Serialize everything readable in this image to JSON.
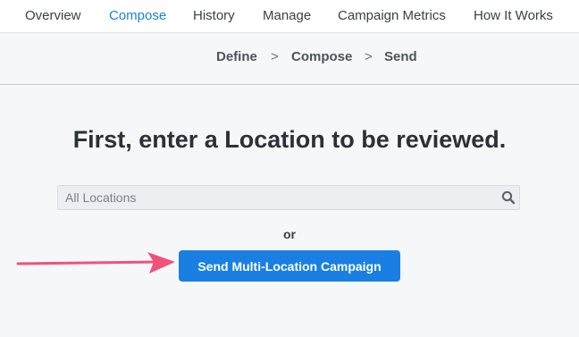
{
  "nav": {
    "items": [
      {
        "label": "Overview",
        "active": false
      },
      {
        "label": "Compose",
        "active": true
      },
      {
        "label": "History",
        "active": false
      },
      {
        "label": "Manage",
        "active": false
      },
      {
        "label": "Campaign Metrics",
        "active": false
      },
      {
        "label": "How It Works",
        "active": false
      }
    ]
  },
  "breadcrumb": {
    "steps": [
      "Define",
      "Compose",
      "Send"
    ],
    "separator": ">"
  },
  "main": {
    "heading": "First, enter a Location to be reviewed.",
    "search_placeholder": "All Locations",
    "search_value": "",
    "search_icon": "search-icon",
    "or_text": "or",
    "button_label": "Send Multi-Location Campaign"
  },
  "annotation": {
    "arrow_icon": "arrow-right-icon"
  },
  "colors": {
    "accent": "#1a7fe3",
    "active_nav": "#1c7ee0",
    "arrow": "#f0527a",
    "background": "#f6f7f9"
  }
}
